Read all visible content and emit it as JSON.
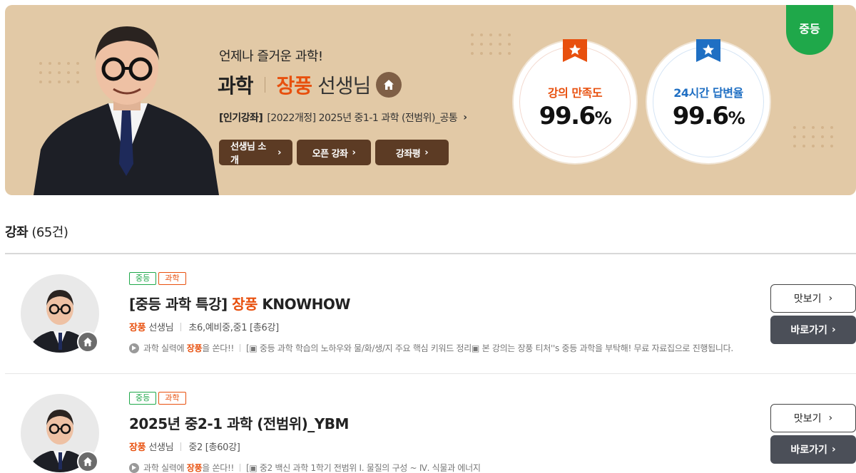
{
  "banner": {
    "intro": "언제나 즐거운 과학!",
    "subject": "과학",
    "teacher_name": "장풍",
    "teacher_suffix": "선생님",
    "popular_tag": "[인기강좌]",
    "popular_text": "[2022개정] 2025년 중1-1 과학 (전범위)_공통",
    "buttons": [
      "선생님 소개",
      "오픈 강좌",
      "강좌평"
    ],
    "level_tab": "중등",
    "stats": [
      {
        "label": "강의 만족도",
        "value": "99.6",
        "unit": "%",
        "color": "#e8500e"
      },
      {
        "label": "24시간 답변율",
        "value": "99.6",
        "unit": "%",
        "color": "#1f6fc3"
      }
    ]
  },
  "section": {
    "title": "강좌",
    "count": "(65건)"
  },
  "courses": [
    {
      "badges": [
        "중등",
        "과학"
      ],
      "title_prefix": "[중등 과학 특강]",
      "title_highlight": "장풍",
      "title_suffix": "KNOWHOW",
      "teacher": "장풍",
      "teacher_suffix": "선생님",
      "meta": "초6,예비중,중1 [총6강]",
      "desc_lead": "과학 실력에",
      "desc_highlight": "장풍",
      "desc_tail": "을 쏜다!!",
      "desc_rest": "[▣ 중등 과학 학습의 노하우와 물/화/생/지 주요 핵심 키워드 정리▣ 본 강의는 장풍 티처''s 중등 과학을 부탁해! 무료 자료집으로 진행됩니다.",
      "preview_label": "맛보기",
      "goto_label": "바로가기"
    },
    {
      "badges": [
        "중등",
        "과학"
      ],
      "title_prefix": "2025년 중2-1 과학 (전범위)_YBM",
      "title_highlight": "",
      "title_suffix": "",
      "teacher": "장풍",
      "teacher_suffix": "선생님",
      "meta": "중2 [총60강]",
      "desc_lead": "과학 실력에",
      "desc_highlight": "장풍",
      "desc_tail": "을 쏜다!!",
      "desc_rest": "[▣ 중2 백신 과학 1학기 전범위 Ⅰ. 물질의 구성 ~ Ⅳ. 식물과 에너지",
      "preview_label": "맛보기",
      "goto_label": "바로가기"
    }
  ],
  "colors": {
    "banner_bg": "#e2c9a6",
    "accent_orange": "#e8500e",
    "accent_blue": "#1f6fc3",
    "level_green": "#1fa84a",
    "button_brown": "#5c3b24",
    "button_dark": "#4b4f58"
  },
  "icons": [
    "home-icon",
    "chevron-right-icon",
    "star-ribbon-icon",
    "play-icon"
  ]
}
